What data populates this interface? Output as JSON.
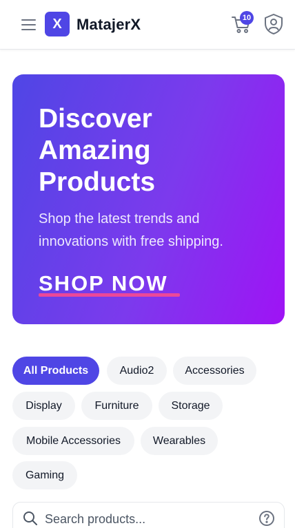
{
  "header": {
    "logo_letter": "X",
    "app_name": "MatajerX",
    "cart_count": "10",
    "icons": [
      "menu-icon",
      "cart-icon",
      "shield-user-icon"
    ]
  },
  "hero": {
    "title": "Discover Amazing Products",
    "subtitle": "Shop the latest trends and innovations with free shipping.",
    "cta_label": "SHOP NOW"
  },
  "categories": {
    "items": [
      "All Products",
      "Audio2",
      "Accessories",
      "Display",
      "Furniture",
      "Storage",
      "Mobile Accessories",
      "Wearables",
      "Gaming"
    ],
    "active": "All Products"
  },
  "search": {
    "placeholder": "Search products..."
  },
  "colors": {
    "brand": "#4f46e5",
    "hero_gradient_start": "#4f46e5",
    "hero_gradient_end": "#9f13f5",
    "cta_underline": "#ec4899",
    "chip_bg": "#f3f4f6"
  }
}
